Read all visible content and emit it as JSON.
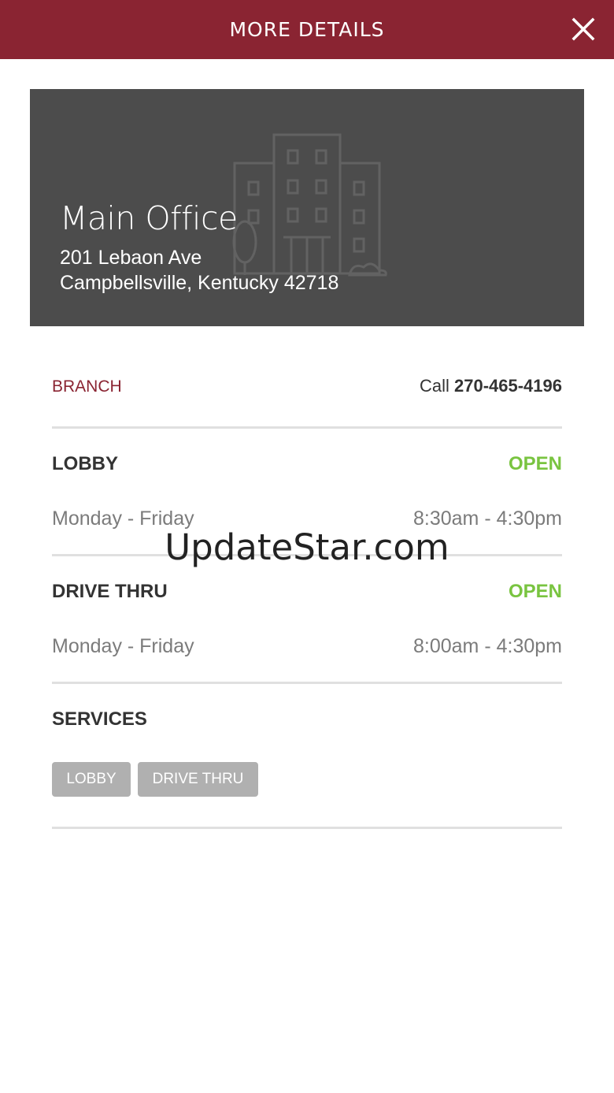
{
  "header": {
    "title": "MORE DETAILS",
    "close_icon": "close-icon"
  },
  "location": {
    "name": "Main Office",
    "address_line1": "201 Lebaon Ave",
    "address_line2": "Campbellsville, Kentucky 42718",
    "image_icon": "building-illustration"
  },
  "branch": {
    "type_label": "BRANCH",
    "call_prefix": "Call",
    "phone": "270-465-4196"
  },
  "lobby": {
    "title": "LOBBY",
    "status": "OPEN",
    "days": "Monday - Friday",
    "hours": "8:30am - 4:30pm"
  },
  "drive_thru": {
    "title": "DRIVE THRU",
    "status": "OPEN",
    "days": "Monday - Friday",
    "hours": "8:00am - 4:30pm"
  },
  "services": {
    "title": "SERVICES",
    "chips": [
      "LOBBY",
      "DRIVE THRU"
    ]
  },
  "watermark": "UpdateStar.com",
  "colors": {
    "brand": "#8a2432",
    "open": "#79c440",
    "hero_bg": "#4c4c4c",
    "chip_bg": "#b0b0b0"
  }
}
